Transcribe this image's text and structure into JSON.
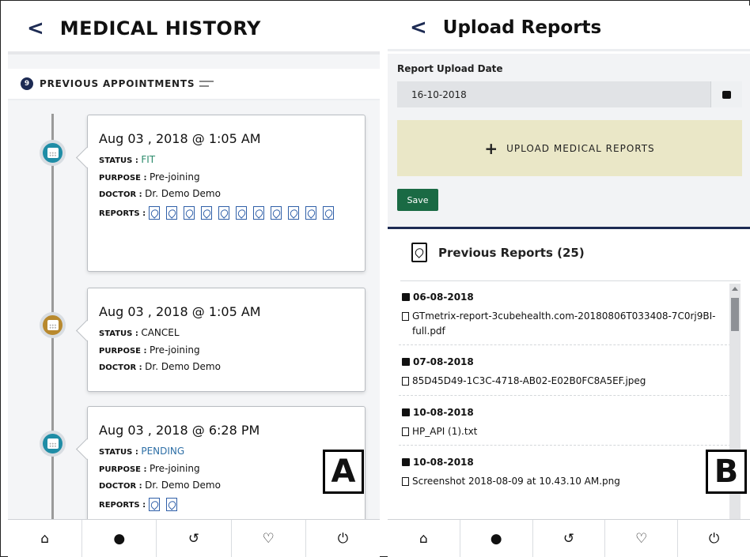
{
  "panel_a": {
    "title": "MEDICAL HISTORY",
    "back_glyph": "<",
    "section": {
      "count": "9",
      "label": "PREVIOUS APPOINTMENTS"
    },
    "labels": {
      "status": "STATUS : ",
      "purpose": "PURPOSE : ",
      "doctor": "DOCTOR : ",
      "reports": "REPORTS : "
    },
    "appointments": [
      {
        "date": "Aug 03 , 2018 @ 1:05 AM",
        "status": "FIT",
        "purpose": "Pre-joining",
        "doctor": "Dr. Demo Demo",
        "report_count": 11,
        "dot_color": "#1f8da6"
      },
      {
        "date": "Aug 03 , 2018 @ 1:05 AM",
        "status": "CANCEL",
        "purpose": "Pre-joining",
        "doctor": "Dr. Demo Demo",
        "report_count": 0,
        "dot_color": "#b8892e"
      },
      {
        "date": "Aug 03 , 2018 @ 6:28 PM",
        "status": "PENDING",
        "purpose": "Pre-joining",
        "doctor": "Dr. Demo Demo",
        "report_count": 2,
        "dot_color": "#1f8da6"
      }
    ],
    "tag": "A"
  },
  "panel_b": {
    "title": "Upload Reports",
    "back_glyph": "<",
    "date_label": "Report Upload Date",
    "date_value": "16-10-2018",
    "upload_label": "UPLOAD MEDICAL REPORTS",
    "upload_glyph": "+",
    "save_label": "Save",
    "previous_reports_title": "Previous Reports (25)",
    "reports": [
      {
        "date": "06-08-2018",
        "file": "GTmetrix-report-3cubehealth.com-20180806T033408-7C0rj9BI-full.pdf"
      },
      {
        "date": "07-08-2018",
        "file": "85D45D49-1C3C-4718-AB02-E02B0FC8A5EF.jpeg"
      },
      {
        "date": "10-08-2018",
        "file": "HP_API (1).txt"
      },
      {
        "date": "10-08-2018",
        "file": "Screenshot 2018-08-09 at 10.43.10 AM.png"
      }
    ],
    "tag": "B"
  },
  "bottom_nav": {
    "items": [
      {
        "icon": "home-icon",
        "glyph": "⌂"
      },
      {
        "icon": "profile-icon",
        "glyph": "●"
      },
      {
        "icon": "history-icon",
        "glyph": "↺"
      },
      {
        "icon": "favorites-icon",
        "glyph": "♡"
      },
      {
        "icon": "power-icon",
        "glyph": "⏻"
      }
    ]
  },
  "colors": {
    "navy": "#1d2b53",
    "teal": "#1f8da6",
    "amber": "#b8892e",
    "save_green": "#1a6a44",
    "upload_bg": "#eae7c7",
    "pdf_blue": "#2f5fa8"
  }
}
